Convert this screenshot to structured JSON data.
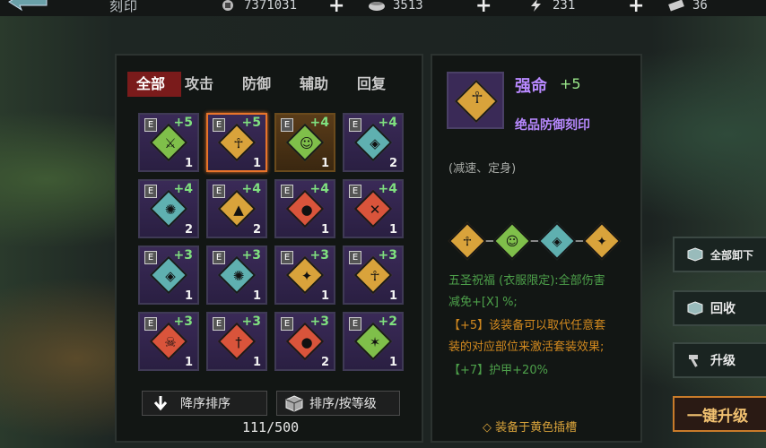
{
  "header": {
    "title": "刻印",
    "resources": [
      {
        "name": "coin",
        "value": "7371031"
      },
      {
        "name": "food",
        "value": "3513"
      },
      {
        "name": "energy",
        "value": "231"
      },
      {
        "name": "ticket",
        "value": "36"
      }
    ]
  },
  "tabs": [
    "全部",
    "攻击",
    "防御",
    "辅助",
    "回复"
  ],
  "active_tab": "全部",
  "grid": [
    {
      "level": "+5",
      "count": "1",
      "color": "#7fbf4a",
      "frame": "purple",
      "icon": "nature-sword-icon"
    },
    {
      "level": "+5",
      "count": "1",
      "color": "#d9a33b",
      "frame": "purple",
      "icon": "meditate-icon",
      "selected": true
    },
    {
      "level": "+4",
      "count": "1",
      "color": "#7fbf4a",
      "frame": "gold",
      "icon": "face-icon"
    },
    {
      "level": "+4",
      "count": "2",
      "color": "#5fb0b0",
      "frame": "purple",
      "icon": "mask-icon"
    },
    {
      "level": "+4",
      "count": "2",
      "color": "#5fb0b0",
      "frame": "purple",
      "icon": "burst-icon"
    },
    {
      "level": "+4",
      "count": "2",
      "color": "#d9a33b",
      "frame": "purple",
      "icon": "hood-icon"
    },
    {
      "level": "+4",
      "count": "1",
      "color": "#d9543b",
      "frame": "purple",
      "icon": "orb-icon"
    },
    {
      "level": "+4",
      "count": "1",
      "color": "#d9543b",
      "frame": "purple",
      "icon": "crossed-blades-icon"
    },
    {
      "level": "+3",
      "count": "1",
      "color": "#5fb0b0",
      "frame": "purple",
      "icon": "mask-icon"
    },
    {
      "level": "+3",
      "count": "1",
      "color": "#5fb0b0",
      "frame": "purple",
      "icon": "burst-icon"
    },
    {
      "level": "+3",
      "count": "1",
      "color": "#d9a33b",
      "frame": "purple",
      "icon": "claw-icon"
    },
    {
      "level": "+3",
      "count": "1",
      "color": "#d9a33b",
      "frame": "purple",
      "icon": "meditate-icon"
    },
    {
      "level": "+3",
      "count": "1",
      "color": "#d9543b",
      "frame": "purple",
      "icon": "demon-icon"
    },
    {
      "level": "+3",
      "count": "1",
      "color": "#d9543b",
      "frame": "purple",
      "icon": "dagger-icon"
    },
    {
      "level": "+3",
      "count": "2",
      "color": "#d9543b",
      "frame": "purple",
      "icon": "orb-icon"
    },
    {
      "level": "+2",
      "count": "1",
      "color": "#7fbf4a",
      "frame": "purple",
      "icon": "leap-icon"
    }
  ],
  "buttons": {
    "sort_desc": "降序排序",
    "sort_level": "排序/按等级"
  },
  "inventory_count": "111/500",
  "detail": {
    "name": "强命",
    "level": "+5",
    "subtitle": "绝品防御刻印",
    "desc_top": "(减速、定身)",
    "set_colors": [
      "#d9a33b",
      "#7fbf4a",
      "#5fb0b0",
      "#d9a33b"
    ],
    "line1": "五圣祝福 (衣服限定):全部伤害",
    "line2": "减免+[X] %;",
    "line3": "【+5】该装备可以取代任意套",
    "line4": "装的对应部位来激活套装效果;",
    "line5": "【+7】护甲+20%",
    "equip_hint": "◇ 装备于黄色插槽"
  },
  "side_buttons": {
    "unequip_all": "全部卸下",
    "recycle": "回收",
    "upgrade": "升级",
    "upgrade_all": "一键升级"
  }
}
